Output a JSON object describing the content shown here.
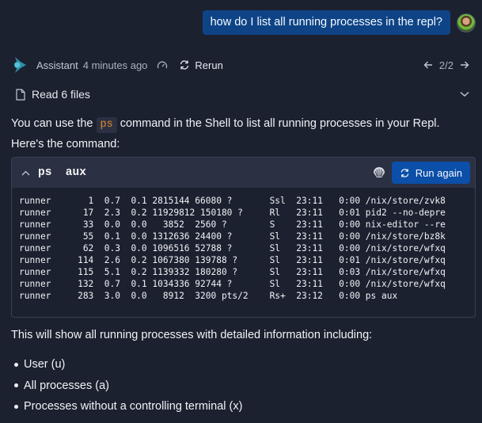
{
  "user_message": {
    "text": "how do I list all running processes in the repl?",
    "avatar": "user-avatar"
  },
  "assistant": {
    "name": "Assistant",
    "time_ago": "4 minutes ago",
    "rerun_label": "Rerun",
    "pager": "2/2",
    "read_files_label": "Read 6 files"
  },
  "content": {
    "intro_before": "You can use the ",
    "intro_code": "ps",
    "intro_after": " command in the Shell to list all running processes in your Repl. Here's the command:",
    "code_block": {
      "command": "ps  aux",
      "run_again_label": "Run again",
      "output_rows": [
        "runner       1  0.7  0.1 2815144 66080 ?       Ssl  23:11   0:00 /nix/store/zvk8",
        "runner      17  2.3  0.2 11929812 150180 ?     Rl   23:11   0:01 pid2 --no-depre",
        "runner      33  0.0  0.0   3852  2560 ?        S    23:11   0:00 nix-editor --re",
        "runner      55  0.1  0.0 1312636 24400 ?       Sl   23:11   0:00 /nix/store/bz8k",
        "runner      62  0.3  0.0 1096516 52788 ?       Sl   23:11   0:00 /nix/store/wfxq",
        "runner     114  2.6  0.2 1067380 139788 ?      Sl   23:11   0:01 /nix/store/wfxq",
        "runner     115  5.1  0.2 1139332 180280 ?      Sl   23:11   0:03 /nix/store/wfxq",
        "runner     132  0.7  0.1 1034336 92744 ?       Sl   23:11   0:00 /nix/store/wfxq",
        "runner     283  3.0  0.0   8912  3200 pts/2    Rs+  23:12   0:00 ps aux"
      ]
    },
    "summary": "This will show all running processes with detailed information including:",
    "bullets": [
      "User (u)",
      "All processes (a)",
      "Processes without a controlling terminal (x)"
    ]
  },
  "colors": {
    "background": "#1c2130",
    "user_bubble": "#0e4486",
    "run_again_button": "#0b4fa8",
    "inline_code_text": "#e28b2f",
    "logo": "#3aa6c0"
  }
}
